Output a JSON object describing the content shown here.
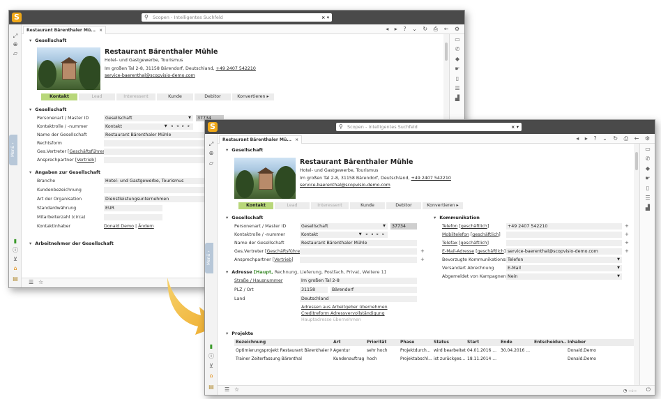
{
  "app": {
    "logo_letter": "S",
    "search_placeholder": "Scopen - Intelligentes Suchfeld",
    "search_ctrl": "× ▾",
    "tab_label": "Restaurant Bärenthaler Mü...",
    "tab_close": "×",
    "menu_label": "Menü ›"
  },
  "company": {
    "section_title": "Gesellschaft",
    "name": "Restaurant Bärenthaler Mühle",
    "industry": "Hotel- und Gastgewerbe, Tourismus",
    "address": "Im großen Tal 2-8, 31158 Bärendorf, Deutschland,",
    "phone": "+49 2407 542210",
    "email": "service-baerenthal@scopvisio-demo.com"
  },
  "stages": [
    "Kontakt",
    "Lead",
    "Interessent",
    "Kunde",
    "Debitor",
    "Konvertieren ▸"
  ],
  "gesellschaft": {
    "title": "Gesellschaft",
    "rows": [
      {
        "label": "Personenart / Master ID",
        "value": "Gesellschaft",
        "extra": "37734"
      },
      {
        "label": "Kontaktrolle / -nummer",
        "value": "Kontakt"
      },
      {
        "label": "Name der Gesellschaft",
        "value": "Restaurant Bärenthaler Mühle"
      },
      {
        "label": "Rechtsform",
        "value": ""
      },
      {
        "label_pre": "Ges.Vertreter [",
        "label_link": "Geschäftsführer",
        "label_post": "]",
        "value": ""
      },
      {
        "label_pre": "Ansprechpartner [",
        "label_link": "Vertrieb",
        "label_post": "]",
        "value": ""
      }
    ]
  },
  "angaben": {
    "title": "Angaben zur Gesellschaft",
    "rows": [
      {
        "label": "Branche",
        "value": "Hotel- und Gastgewerbe, Tourismus"
      },
      {
        "label": "Kundenbezeichnung",
        "value": ""
      },
      {
        "label": "Art der Organisation",
        "value": "Dienstleistungsunternehmen"
      },
      {
        "label": "Standardwährung",
        "value": "EUR"
      },
      {
        "label": "Mitarbeiterzahl (circa)",
        "value": ""
      },
      {
        "label": "Kontaktinhaber",
        "value_link1": "Donald Demo",
        "value_sep": " | ",
        "value_link2": "Ändern"
      }
    ]
  },
  "arbeitnehmer_title": "Arbeitnehmer der Gesellschaft",
  "kommunikation": {
    "title": "Kommunikation",
    "rows": [
      {
        "label_link": "Telefon",
        "label_post": " [",
        "label_link2": "geschäftlich",
        "label_end": "]",
        "value": "+49 2407 542210"
      },
      {
        "label_link": "Mobiltelefon",
        "label_post": " [",
        "label_link2": "geschäftlich",
        "label_end": "]",
        "value": ""
      },
      {
        "label_link": "Telefax",
        "label_post": " [",
        "label_link2": "geschäftlich",
        "label_end": "]",
        "value": ""
      },
      {
        "label_link": "E-Mail-Adresse",
        "label_post": " [",
        "label_link2": "geschäftlich",
        "label_end": "]",
        "value": "service-baerenthal@scopvisio-demo.com"
      },
      {
        "label": "Bevorzugte Kommunikationsart",
        "value": "Telefon"
      },
      {
        "label": "Versandart Abrechnung",
        "value": "E-Mail"
      },
      {
        "label": "Abgemeldet von Kampagnen",
        "value": "Nein"
      }
    ]
  },
  "adresse": {
    "title": "Adresse",
    "subtitle_active": "[Haupt,",
    "subtitle_rest": " Rechnung, Lieferung, Postfach, Privat, Weitere 1]",
    "street_label": "Straße / Hausnummer",
    "street_value": "Im großen Tal 2-8",
    "plz_label": "PLZ / Ort",
    "plz_value": "31158",
    "city_value": "Bärendorf",
    "country_label": "Land",
    "country_value": "Deutschland",
    "link1": "Adressen aus Arbeitgeber übernehmen",
    "link2": "Creditreform Adressvervollständigung",
    "link3": "Hauptadresse übernehmen"
  },
  "projekte": {
    "title": "Projekte",
    "columns": [
      "Bezeichnung",
      "Art",
      "Priorität",
      "Phase",
      "Status",
      "Start",
      "Ende",
      "Entscheidun...",
      "Inhaber"
    ],
    "rows": [
      [
        "Optimierungsprojekt Restaurant Bärenthaler M...",
        "Agentur",
        "sehr hoch",
        "Projektdurch...",
        "wird bearbeitet",
        "04.01.2016 ...",
        "30.04.2016 ...",
        "",
        "Donald.Demo"
      ],
      [
        "Trainer Zeiterfassung Bärenthal",
        "Kundenauftrag",
        "hoch",
        "Projektabschl...",
        "ist zurückges...",
        "18.11.2014 ...",
        "",
        "",
        "Donald.Demo"
      ]
    ]
  },
  "statusbar": {
    "timer": "--:--"
  },
  "colors": {
    "brand": "#f0a818",
    "topbar": "#4a4a4a",
    "stage_active": "#b8d77a",
    "arrow": "#f2b838"
  }
}
